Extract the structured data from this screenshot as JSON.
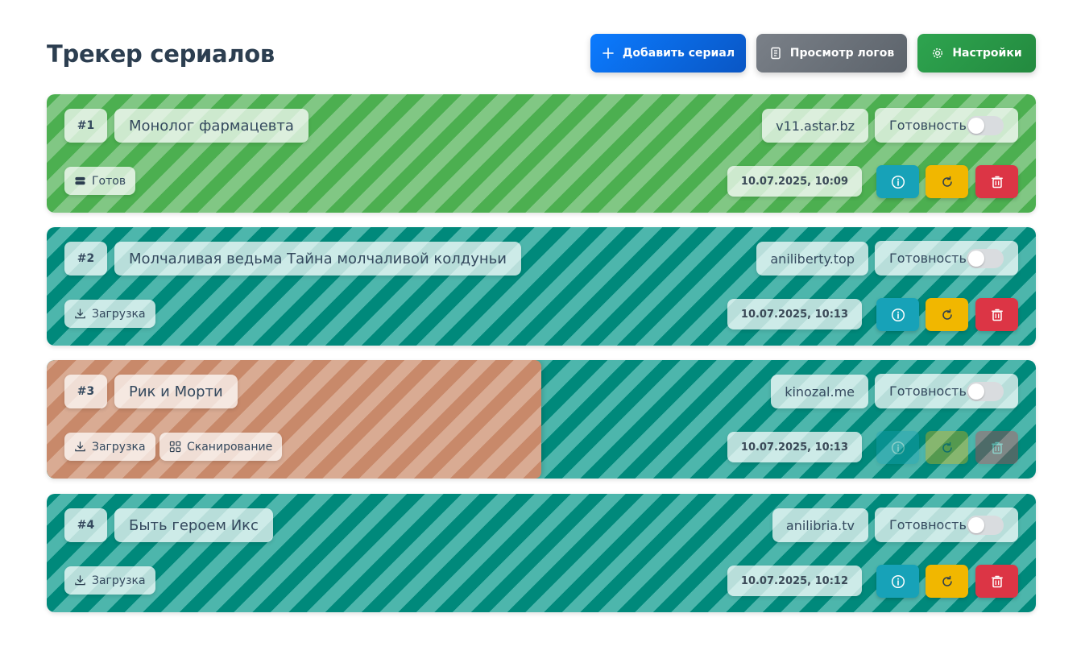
{
  "header": {
    "title": "Трекер сериалов",
    "add_label": "Добавить сериал",
    "logs_label": "Просмотр логов",
    "settings_label": "Настройки"
  },
  "ready_label": "Готовность",
  "series": [
    {
      "number": "#1",
      "title": "Монолог фармацевта",
      "site": "v11.astar.bz",
      "status": [
        {
          "icon": "storage-icon",
          "label": "Готов"
        }
      ],
      "date": "10.07.2025, 10:09",
      "ready": false,
      "color": "#4caf50"
    },
    {
      "number": "#2",
      "title": "Молчаливая ведьма Тайна молчаливой колдуньи",
      "site": "aniliberty.top",
      "status": [
        {
          "icon": "download-icon",
          "label": "Загрузка"
        }
      ],
      "date": "10.07.2025, 10:13",
      "ready": false,
      "color": "#00897b"
    },
    {
      "number": "#3",
      "title": "Рик и Морти",
      "site": "kinozal.me",
      "status": [
        {
          "icon": "download-icon",
          "label": "Загрузка"
        },
        {
          "icon": "scan-icon",
          "label": "Сканирование"
        }
      ],
      "date": "10.07.2025, 10:13",
      "ready": false,
      "progress": 0.5,
      "actions_disabled": true,
      "color": "#00897b"
    },
    {
      "number": "#4",
      "title": "Быть героем Икс",
      "site": "anilibria.tv",
      "status": [
        {
          "icon": "download-icon",
          "label": "Загрузка"
        }
      ],
      "date": "10.07.2025, 10:12",
      "ready": false,
      "color": "#00897b"
    }
  ]
}
